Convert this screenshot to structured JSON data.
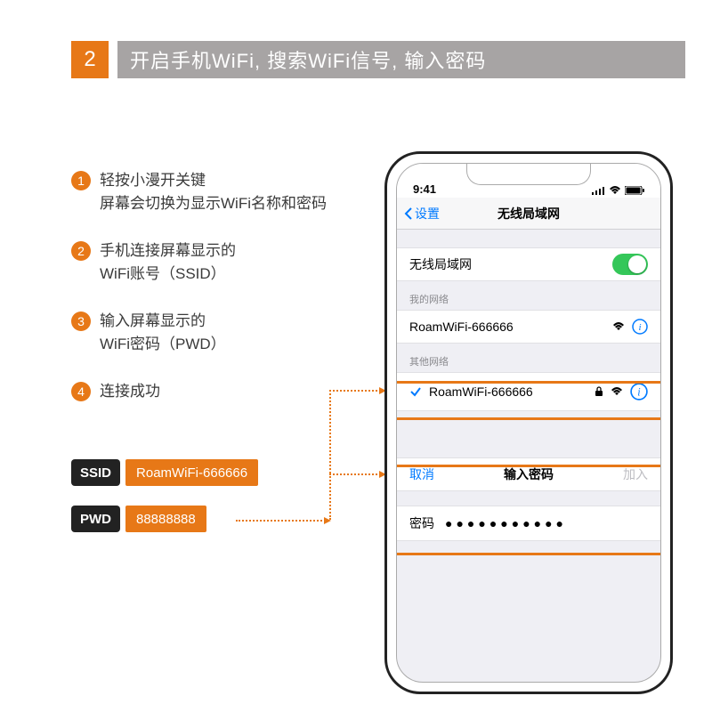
{
  "step": {
    "number": "2",
    "title": "开启手机WiFi, 搜索WiFi信号, 输入密码"
  },
  "instructions": [
    {
      "n": "1",
      "text_a": "轻按小漫开关键",
      "text_b": "屏幕会切换为显示WiFi名称和密码"
    },
    {
      "n": "2",
      "text_a": "手机连接屏幕显示的",
      "text_b": "WiFi账号（SSID）"
    },
    {
      "n": "3",
      "text_a": "输入屏幕显示的",
      "text_b": "WiFi密码（PWD）"
    },
    {
      "n": "4",
      "text_a": "连接成功",
      "text_b": ""
    }
  ],
  "creds": {
    "ssid_label": "SSID",
    "ssid_value": "RoamWiFi-666666",
    "pwd_label": "PWD",
    "pwd_value": "88888888"
  },
  "phone": {
    "time": "9:41",
    "back": "设置",
    "title": "无线局域网",
    "wlan_label": "无线局域网",
    "section_my": "我的网络",
    "my_network": "RoamWiFi-666666",
    "section_other": "其他网络",
    "other_network": "RoamWiFi-666666",
    "pwd_cancel": "取消",
    "pwd_title": "输入密码",
    "pwd_join": "加入",
    "pwd_field_label": "密码",
    "pwd_dots": "●●●●●●●●●●●"
  }
}
